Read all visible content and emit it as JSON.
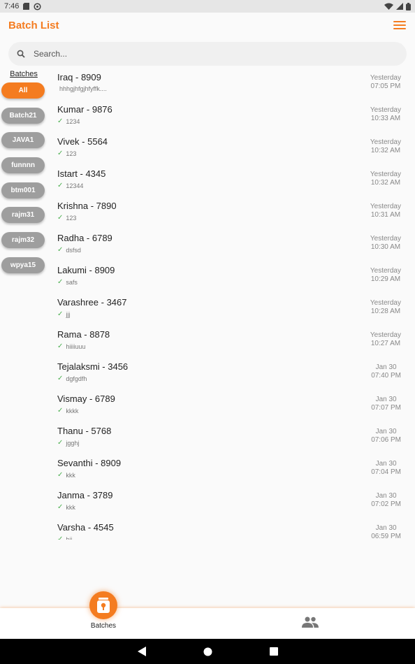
{
  "status_bar": {
    "time": "7:46"
  },
  "app": {
    "title": "Batch List"
  },
  "search": {
    "placeholder": "Search..."
  },
  "sidebar": {
    "header": "Batches",
    "batches": [
      {
        "label": "All",
        "active": true
      },
      {
        "label": "Batch21",
        "active": false
      },
      {
        "label": "JAVA1",
        "active": false
      },
      {
        "label": "funnnn",
        "active": false
      },
      {
        "label": "btm001",
        "active": false
      },
      {
        "label": "rajm31",
        "active": false
      },
      {
        "label": "rajm32",
        "active": false
      },
      {
        "label": "wpya15",
        "active": false
      }
    ]
  },
  "list": [
    {
      "name": "Iraq - 8909",
      "sub": "hhhgjhfgjhfyffk....",
      "checked": false,
      "day": "Yesterday",
      "time": "07:05 PM"
    },
    {
      "name": "Kumar - 9876",
      "sub": "1234",
      "checked": true,
      "day": "Yesterday",
      "time": "10:33 AM"
    },
    {
      "name": "Vivek - 5564",
      "sub": "123",
      "checked": true,
      "day": "Yesterday",
      "time": "10:32 AM"
    },
    {
      "name": "Istart - 4345",
      "sub": "12344",
      "checked": true,
      "day": "Yesterday",
      "time": "10:32 AM"
    },
    {
      "name": "Krishna - 7890",
      "sub": "123",
      "checked": true,
      "day": "Yesterday",
      "time": "10:31 AM"
    },
    {
      "name": "Radha - 6789",
      "sub": "dsfsd",
      "checked": true,
      "day": "Yesterday",
      "time": "10:30 AM"
    },
    {
      "name": "Lakumi - 8909",
      "sub": "safs",
      "checked": true,
      "day": "Yesterday",
      "time": "10:29 AM"
    },
    {
      "name": "Varashree - 3467",
      "sub": "jjj",
      "checked": true,
      "day": "Yesterday",
      "time": "10:28 AM"
    },
    {
      "name": "Rama - 8878",
      "sub": "hiiiiuuu",
      "checked": true,
      "day": "Yesterday",
      "time": "10:27 AM"
    },
    {
      "name": "Tejalaksmi - 3456",
      "sub": "dgfgdfh",
      "checked": true,
      "day": "Jan 30",
      "time": "07:40 PM"
    },
    {
      "name": "Vismay - 6789",
      "sub": "kkkk",
      "checked": true,
      "day": "Jan 30",
      "time": "07:07 PM"
    },
    {
      "name": "Thanu - 5768",
      "sub": "jgghj",
      "checked": true,
      "day": "Jan 30",
      "time": "07:06 PM"
    },
    {
      "name": "Sevanthi - 8909",
      "sub": "kkk",
      "checked": true,
      "day": "Jan 30",
      "time": "07:04 PM"
    },
    {
      "name": "Janma - 3789",
      "sub": "kkk",
      "checked": true,
      "day": "Jan 30",
      "time": "07:02 PM"
    },
    {
      "name": "Varsha - 4545",
      "sub": "hji",
      "checked": true,
      "day": "Jan 30",
      "time": "06:59 PM"
    }
  ],
  "bottom_nav": {
    "batches_label": "Batches"
  },
  "colors": {
    "accent": "#f47c20",
    "inactive_pill": "#9e9e9e",
    "check": "#4caf50"
  }
}
